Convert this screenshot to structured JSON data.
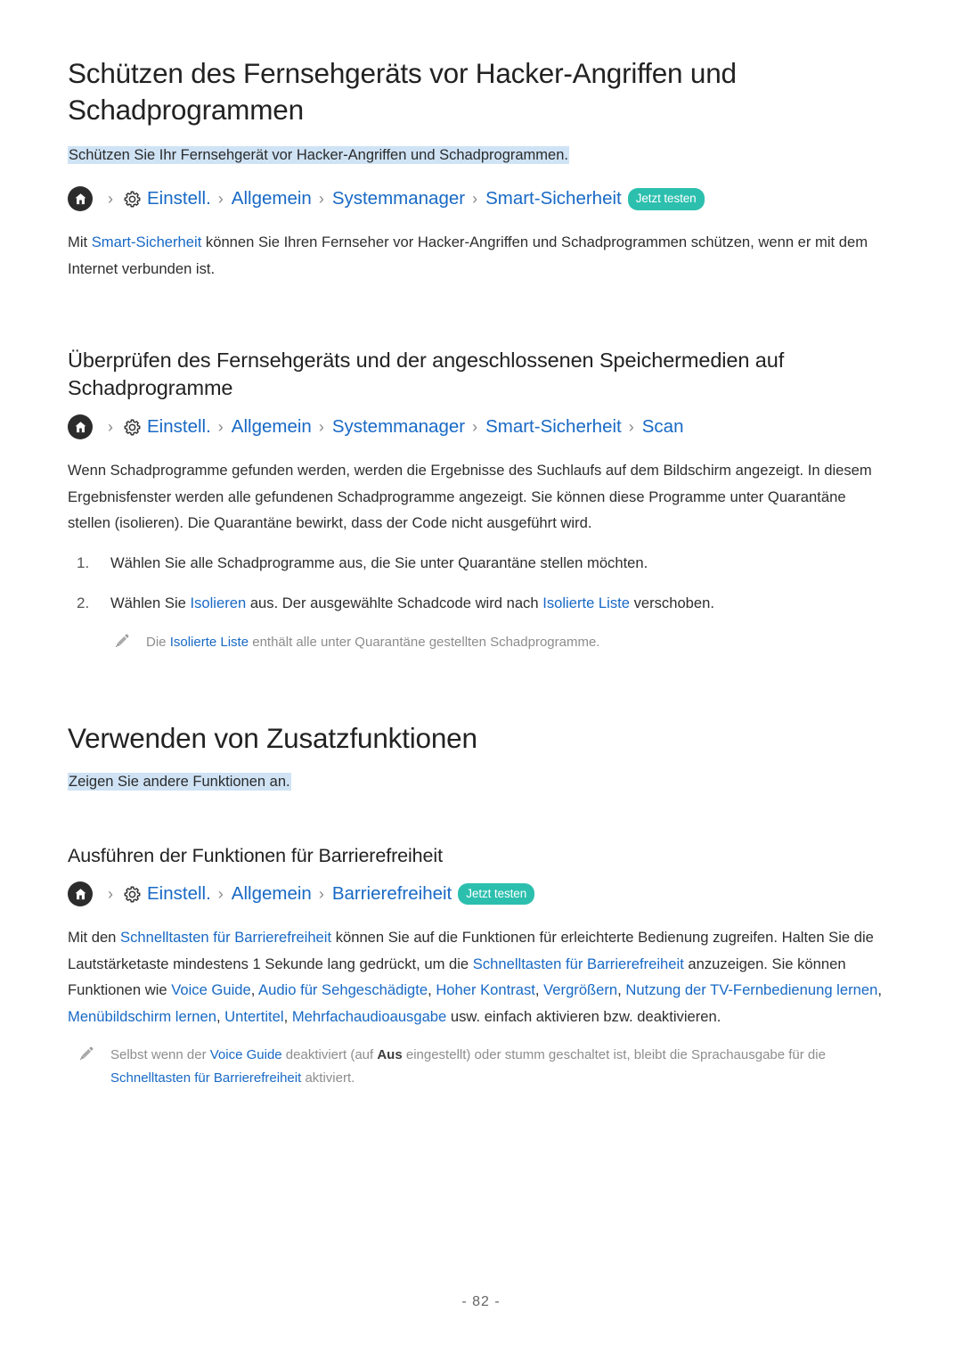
{
  "document": {
    "title": "Schützen des Fernsehgeräts vor Hacker-Angriffen und Schadprogrammen",
    "lead": "Schützen Sie Ihr Fernsehgerät vor Hacker-Angriffen und Schadprogrammen.",
    "page_number": "- 82 -",
    "colors": {
      "link": "#1869c5",
      "badge": "#2cbfae",
      "highlight": "#cfe3f5",
      "text": "#2e2e2e",
      "note": "#8d8d8d"
    }
  },
  "section1": {
    "breadcrumb": {
      "home_icon": "home-icon",
      "gear_icon": "gear-icon",
      "separator": "›",
      "items": [
        "Einstell.",
        "Allgemein",
        "Systemmanager",
        "Smart-Sicherheit"
      ],
      "badge": "Jetzt testen"
    },
    "paragraph": {
      "before": "Mit ",
      "link": "Smart-Sicherheit",
      "after": " können Sie Ihren Fernseher vor Hacker-Angriffen und Schadprogrammen schützen, wenn er mit dem Internet verbunden ist."
    }
  },
  "section2": {
    "heading": "Überprüfen des Fernsehgeräts und der angeschlossenen Speichermedien auf Schadprogramme",
    "breadcrumb": {
      "home_icon": "home-icon",
      "gear_icon": "gear-icon",
      "separator": "›",
      "items": [
        "Einstell.",
        "Allgemein",
        "Systemmanager",
        "Smart-Sicherheit",
        "Scan"
      ]
    },
    "paragraph": "Wenn Schadprogramme gefunden werden, werden die Ergebnisse des Suchlaufs auf dem Bildschirm angezeigt. In diesem Ergebnisfenster werden alle gefundenen Schadprogramme angezeigt. Sie können diese Programme unter Quarantäne stellen (isolieren). Die Quarantäne bewirkt, dass der Code nicht ausgeführt wird.",
    "steps": [
      {
        "num": "1.",
        "text": "Wählen Sie alle Schadprogramme aus, die Sie unter Quarantäne stellen möchten."
      },
      {
        "num": "2.",
        "before": "Wählen Sie ",
        "link1": "Isolieren",
        "middle": " aus. Der ausgewählte Schadcode wird nach ",
        "link2": "Isolierte Liste",
        "after": " verschoben."
      }
    ],
    "note": {
      "icon": "pencil-icon",
      "before": "Die ",
      "link": "Isolierte Liste",
      "after": " enthält alle unter Quarantäne gestellten Schadprogramme."
    }
  },
  "section3": {
    "heading": "Verwenden von Zusatzfunktionen",
    "lead": "Zeigen Sie andere Funktionen an.",
    "subsection": {
      "heading": "Ausführen der Funktionen für Barrierefreiheit",
      "breadcrumb": {
        "home_icon": "home-icon",
        "gear_icon": "gear-icon",
        "separator": "›",
        "items": [
          "Einstell.",
          "Allgemein",
          "Barrierefreiheit"
        ],
        "badge": "Jetzt testen"
      },
      "paragraph": {
        "p1": "Mit den ",
        "l1": "Schnelltasten für Barrierefreiheit",
        "p2": " können Sie auf die Funktionen für erleichterte Bedienung zugreifen. Halten Sie die Lautstärketaste mindestens 1 Sekunde lang gedrückt, um die ",
        "l2": "Schnelltasten für Barrierefreiheit",
        "p3": " anzuzeigen. Sie können Funktionen wie ",
        "l3": "Voice Guide",
        "p4": ", ",
        "l4": "Audio für Sehgeschädigte",
        "p5": ", ",
        "l5": "Hoher Kontrast",
        "p6": ", ",
        "l6": "Vergrößern",
        "p7": ", ",
        "l7": "Nutzung der TV-Fernbedienung lernen",
        "p8": ", ",
        "l8": "Menübildschirm lernen",
        "p9": ", ",
        "l9": "Untertitel",
        "p10": ", ",
        "l10": "Mehrfachaudioausgabe",
        "p11": " usw. einfach aktivieren bzw. deaktivieren."
      },
      "note": {
        "icon": "pencil-icon",
        "n1": "Selbst wenn der ",
        "nl1": "Voice Guide",
        "n2": " deaktiviert (auf ",
        "nb1": "Aus",
        "n3": " eingestellt) oder stumm geschaltet ist, bleibt die Sprachausgabe für die ",
        "nl2": "Schnelltasten für Barrierefreiheit",
        "n4": " aktiviert."
      }
    }
  }
}
